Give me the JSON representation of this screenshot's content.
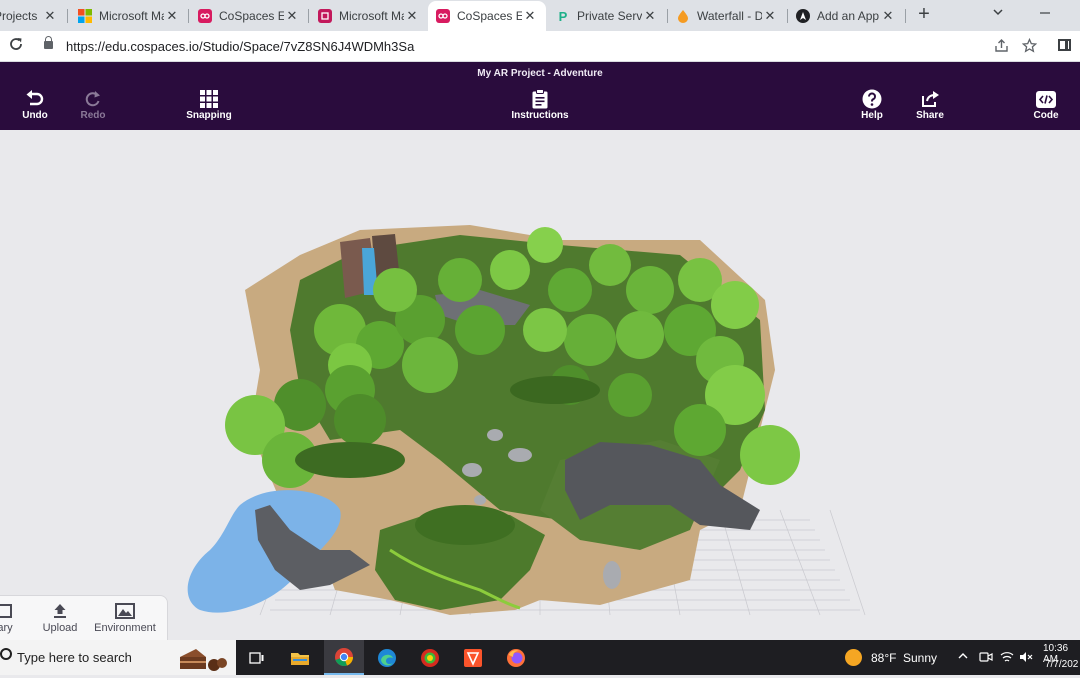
{
  "browser": {
    "tabs": [
      {
        "title": "Projects",
        "favicon": "cospaces-icon",
        "color": "#c2185b"
      },
      {
        "title": "Microsoft Ma",
        "favicon": "microsoft-icon",
        "color": "#f25022"
      },
      {
        "title": "CoSpaces Edu",
        "favicon": "cospaces-icon",
        "color": "#d81b60"
      },
      {
        "title": "Microsoft Ma",
        "favicon": "cospaces-icon",
        "color": "#c2185b"
      },
      {
        "title": "CoSpaces Edu",
        "favicon": "cospaces-icon",
        "color": "#d81b60",
        "active": true
      },
      {
        "title": "Private Server",
        "favicon": "p-icon",
        "color": "#1db089"
      },
      {
        "title": "Waterfall - Do",
        "favicon": "drop-icon",
        "color": "#f59b22"
      },
      {
        "title": "Add an App",
        "favicon": "app-icon",
        "color": "#202124"
      }
    ],
    "close_glyph": "✕",
    "new_tab_glyph": "+",
    "url": "https://edu.cospaces.io/Studio/Space/7vZ8SN6J4WDMh3Sa"
  },
  "toolbar": {
    "title": "My AR Project - Adventure",
    "undo_label": "Undo",
    "redo_label": "Redo",
    "snapping_label": "Snapping",
    "instructions_label": "Instructions",
    "help_label": "Help",
    "share_label": "Share",
    "code_label": "Code"
  },
  "dock": {
    "library_label": "ary",
    "upload_label": "Upload",
    "environment_label": "Environment"
  },
  "taskbar": {
    "search_placeholder": "Type here to search",
    "weather_temp": "88°F",
    "weather_text": "Sunny",
    "time": "10:36 AM",
    "date": "7/7/202"
  },
  "colors": {
    "toolbar_bg": "#2a0c3d",
    "tabstrip_bg": "#dee1e6",
    "viewport_bg": "#e9e9ec",
    "taskbar_bg": "#1e1e22"
  }
}
